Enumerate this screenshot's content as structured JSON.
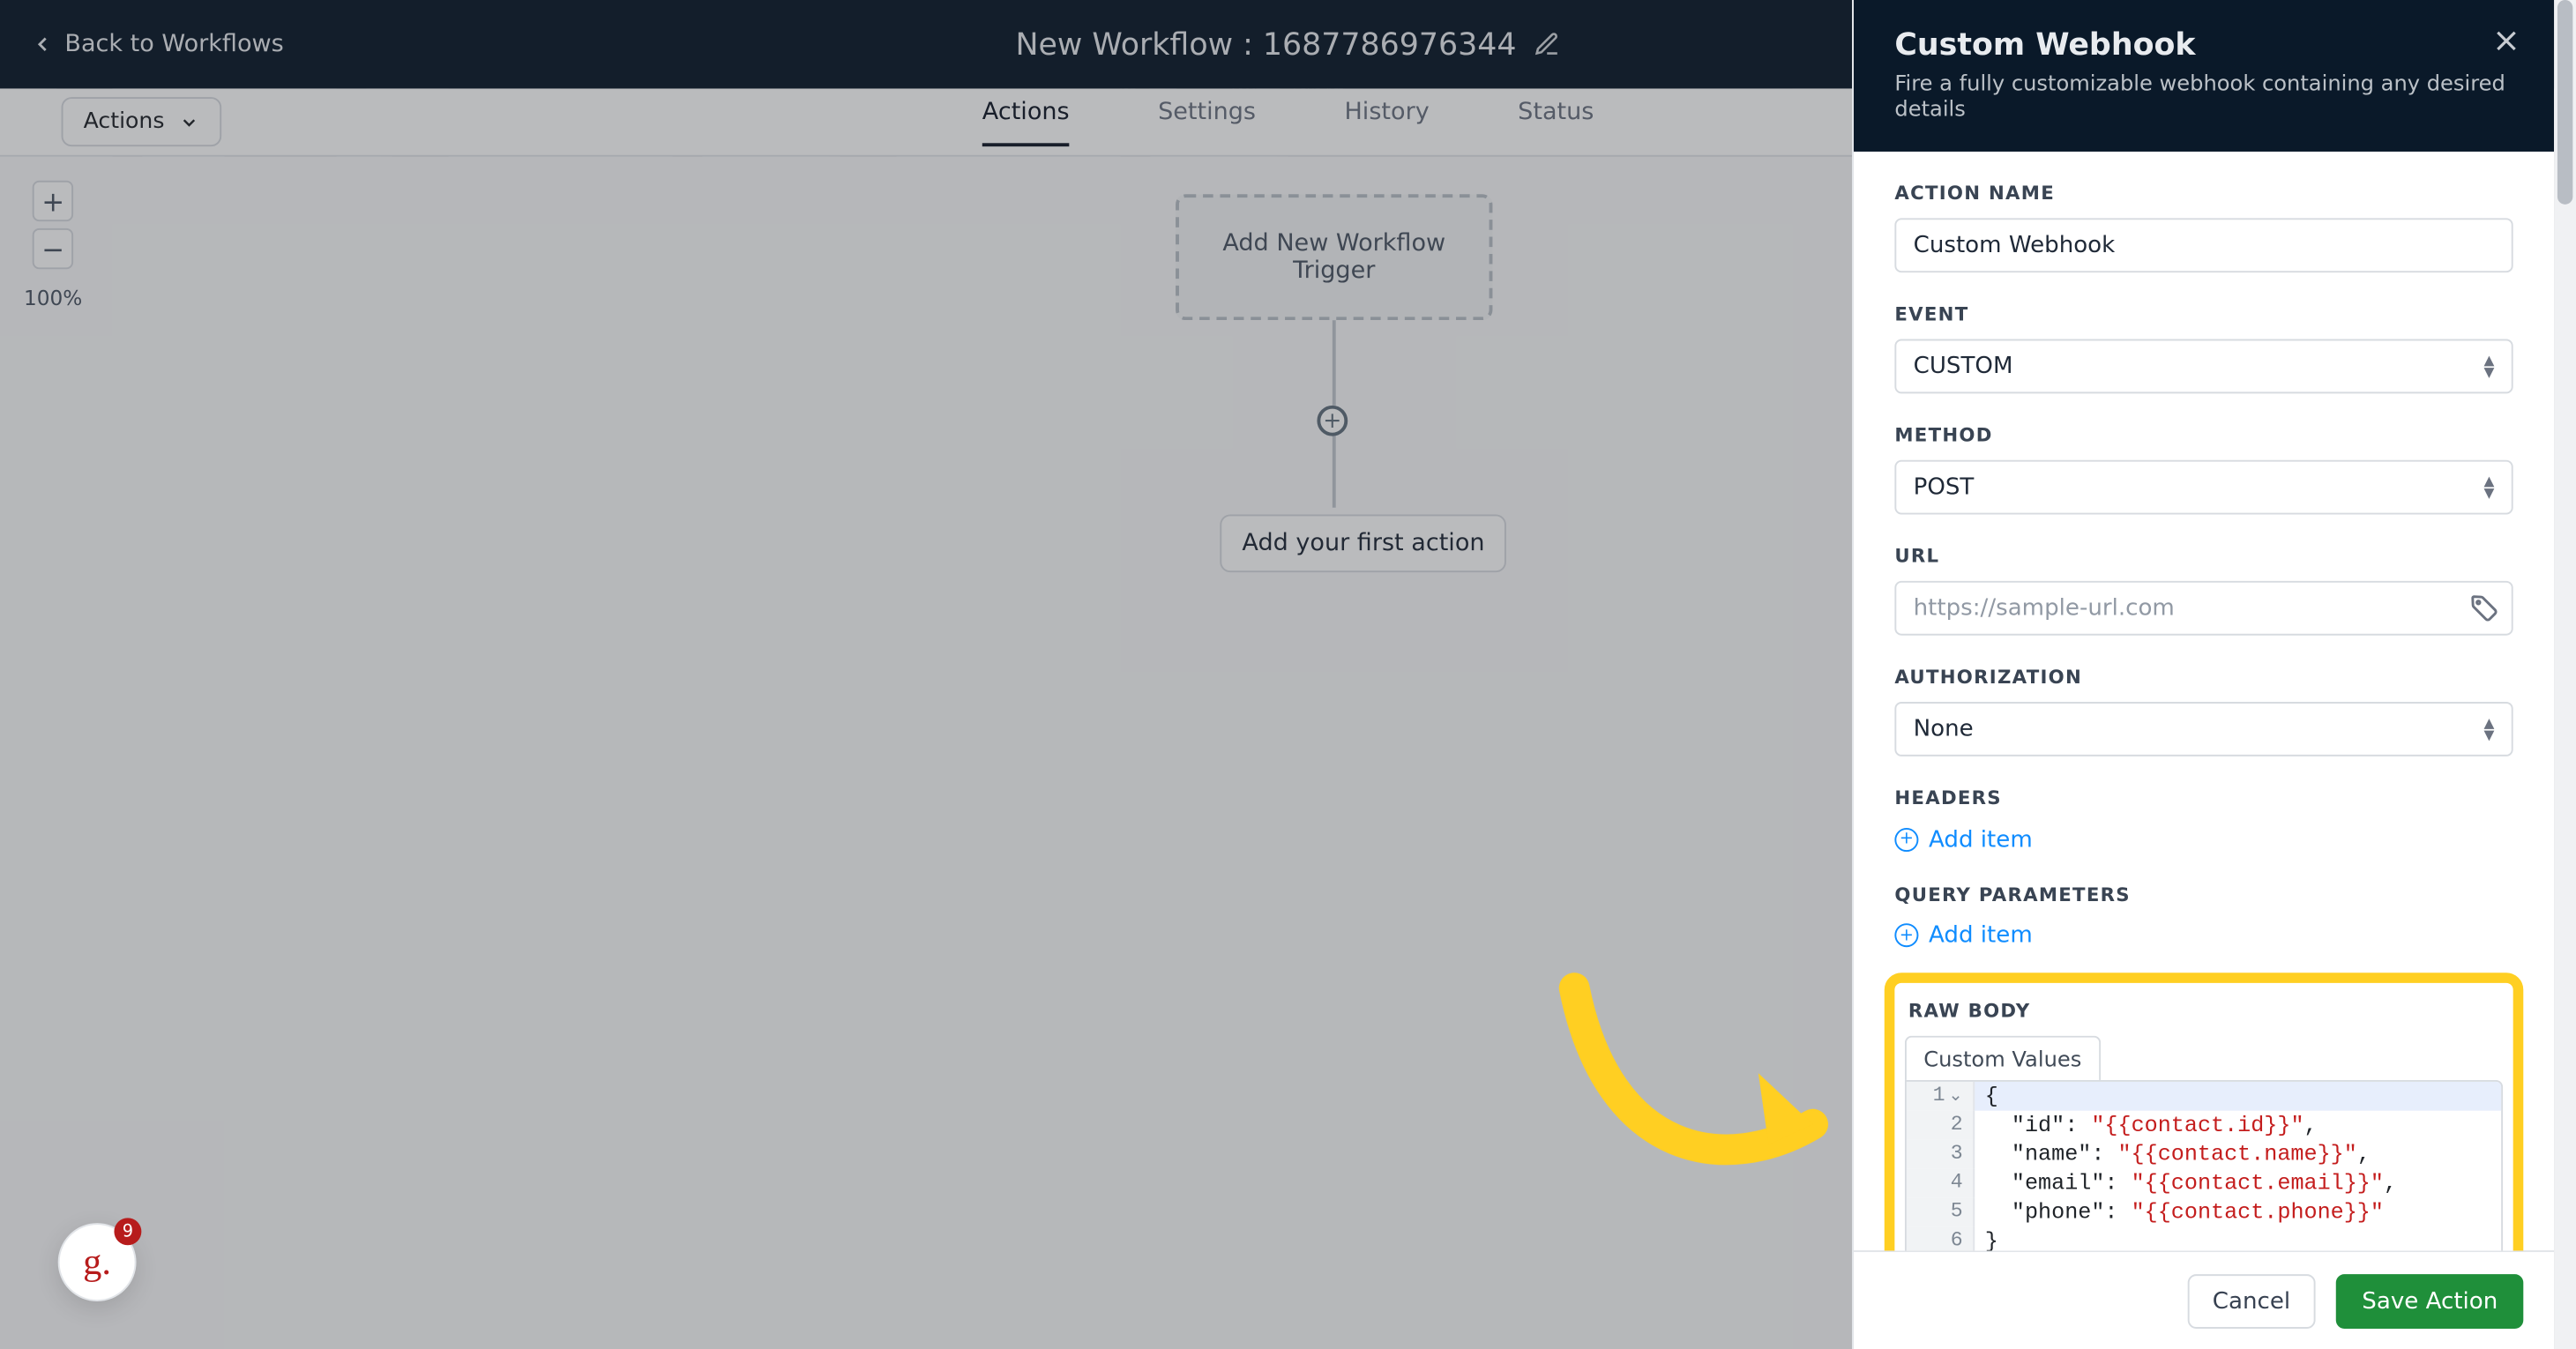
{
  "topbar": {
    "back_label": "Back to Workflows",
    "title": "New Workflow : 1687786976344"
  },
  "subnav": {
    "actions_dropdown": "Actions",
    "tabs": {
      "actions": "Actions",
      "settings": "Settings",
      "history": "History",
      "status": "Status"
    }
  },
  "canvas": {
    "zoom": "100%",
    "trigger_card": "Add New Workflow Trigger",
    "first_action": "Add your first action"
  },
  "panel": {
    "title": "Custom Webhook",
    "subtitle": "Fire a fully customizable webhook containing any desired details",
    "labels": {
      "action_name": "ACTION NAME",
      "event": "EVENT",
      "method": "METHOD",
      "url": "URL",
      "authorization": "AUTHORIZATION",
      "headers": "HEADERS",
      "query_params": "QUERY PARAMETERS",
      "raw_body": "RAW BODY"
    },
    "fields": {
      "action_name": "Custom Webhook",
      "event": "CUSTOM",
      "method": "POST",
      "url_placeholder": "https://sample-url.com",
      "authorization": "None",
      "add_item": "Add item",
      "custom_values_tab": "Custom Values"
    },
    "code_lines": [
      {
        "n": "1",
        "plain": "{",
        "str": ""
      },
      {
        "n": "2",
        "plain": "  \"id\": ",
        "str": "\"{{contact.id}}\"",
        "tail": ","
      },
      {
        "n": "3",
        "plain": "  \"name\": ",
        "str": "\"{{contact.name}}\"",
        "tail": ","
      },
      {
        "n": "4",
        "plain": "  \"email\": ",
        "str": "\"{{contact.email}}\"",
        "tail": ","
      },
      {
        "n": "5",
        "plain": "  \"phone\": ",
        "str": "\"{{contact.phone}}\"",
        "tail": ""
      },
      {
        "n": "6",
        "plain": "}",
        "str": ""
      }
    ],
    "footer": {
      "cancel": "Cancel",
      "save": "Save Action"
    }
  },
  "bubble": {
    "badge": "9"
  }
}
